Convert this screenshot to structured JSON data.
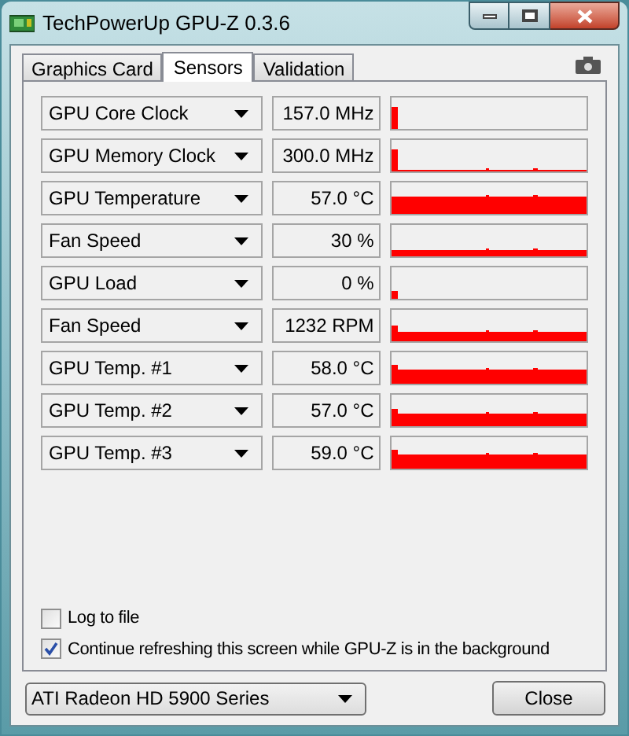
{
  "window": {
    "title": "TechPowerUp GPU-Z 0.3.6"
  },
  "tabs": [
    {
      "label": "Graphics Card",
      "selected": false
    },
    {
      "label": "Sensors",
      "selected": true
    },
    {
      "label": "Validation",
      "selected": false
    }
  ],
  "sensors": [
    {
      "name": "GPU Core Clock",
      "value": "157.0 MHz"
    },
    {
      "name": "GPU Memory Clock",
      "value": "300.0 MHz"
    },
    {
      "name": "GPU Temperature",
      "value": "57.0 °C"
    },
    {
      "name": "Fan Speed",
      "value": "30 %"
    },
    {
      "name": "GPU Load",
      "value": "0 %"
    },
    {
      "name": "Fan Speed",
      "value": "1232 RPM"
    },
    {
      "name": "GPU Temp. #1",
      "value": "58.0 °C"
    },
    {
      "name": "GPU Temp. #2",
      "value": "57.0 °C"
    },
    {
      "name": "GPU Temp. #3",
      "value": "59.0 °C"
    }
  ],
  "options": [
    {
      "label": "Log to file",
      "checked": false
    },
    {
      "label": "Continue refreshing this screen while GPU-Z is in the background",
      "checked": true
    }
  ],
  "card_select": {
    "value": "ATI Radeon HD 5900 Series"
  },
  "close_button": "Close"
}
